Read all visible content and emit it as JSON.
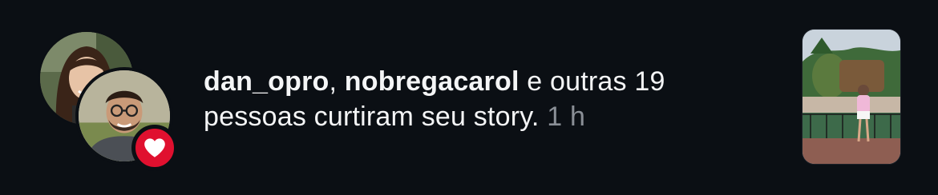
{
  "notification": {
    "user_1": "dan_opro",
    "separator": ", ",
    "user_2": "nobregacarol",
    "message_line1_rest": " e outras 19",
    "message_line2": "pessoas curtiram seu story.",
    "timestamp": "1 h"
  },
  "icons": {
    "badge": "heart-icon",
    "badge_color": "#e0102f"
  },
  "colors": {
    "background": "#0b0f14",
    "text": "#f4f5f6",
    "muted": "#8a8f96"
  }
}
